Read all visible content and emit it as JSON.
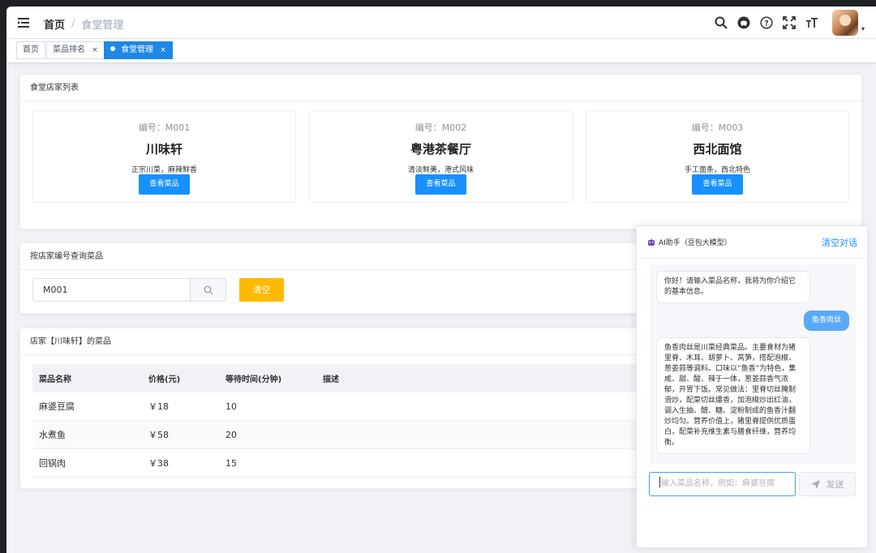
{
  "navbar": {
    "breadcrumb": [
      "首页",
      "食堂管理"
    ],
    "icons": [
      "search-icon",
      "github-icon",
      "question-icon",
      "fullscreen-icon",
      "font-size-icon"
    ],
    "avatar_caret": "▾"
  },
  "tags": [
    {
      "label": "首页",
      "closable": false,
      "active": false
    },
    {
      "label": "菜品排名",
      "close": "×",
      "active": false
    },
    {
      "label": "食堂管理",
      "close": "×",
      "active": true
    }
  ],
  "stores_card": {
    "title": "食堂店家列表",
    "stores": [
      {
        "code": "编号：M001",
        "name": "川味轩",
        "desc": "正宗川菜，麻辣鲜香",
        "button": "查看菜品"
      },
      {
        "code": "编号：M002",
        "name": "粤港茶餐厅",
        "desc": "清淡鲜美，港式风味",
        "button": "查看菜品"
      },
      {
        "code": "编号：M003",
        "name": "西北面馆",
        "desc": "手工面条，西北特色",
        "button": "查看菜品"
      }
    ]
  },
  "search_card": {
    "title": "按店家编号查询菜品",
    "input_value": "M001",
    "clear_label": "清空"
  },
  "dish_card": {
    "title": "店家【川味轩】的菜品",
    "columns": [
      "菜品名称",
      "价格(元)",
      "等待时间(分钟)",
      "描述"
    ],
    "rows": [
      [
        "麻婆豆腐",
        "￥18",
        "10",
        ""
      ],
      [
        "水煮鱼",
        "￥58",
        "20",
        ""
      ],
      [
        "回锅肉",
        "￥38",
        "15",
        ""
      ]
    ]
  },
  "ai_panel": {
    "title": "AI助手（豆包大模型）",
    "clear_label": "清空对话",
    "messages": [
      {
        "role": "assistant",
        "text": "你好！请输入菜品名称，我将为你介绍它的基本信息。"
      },
      {
        "role": "user",
        "text": "鱼香肉丝"
      },
      {
        "role": "assistant",
        "text": "鱼香肉丝是川菜经典菜品。主要食材为猪里脊、木耳、胡萝卜、莴笋，搭配泡椒、葱姜蒜等调料。口味以“鱼香”为特色，集咸、甜、酸、辣于一体，葱姜蒜香气浓郁，开胃下饭。常见做法：里脊切丝腌制滑炒，配菜切丝爆香，加泡椒炒出红油，调入生抽、醋、糖、淀粉制成的鱼香汁翻炒均匀。营养价值上，猪里脊提供优质蛋白，配菜补充维生素与膳食纤维，营养均衡。"
      }
    ],
    "input_placeholder": "输入菜品名称，例如：麻婆豆腐",
    "send_label": "发送"
  }
}
